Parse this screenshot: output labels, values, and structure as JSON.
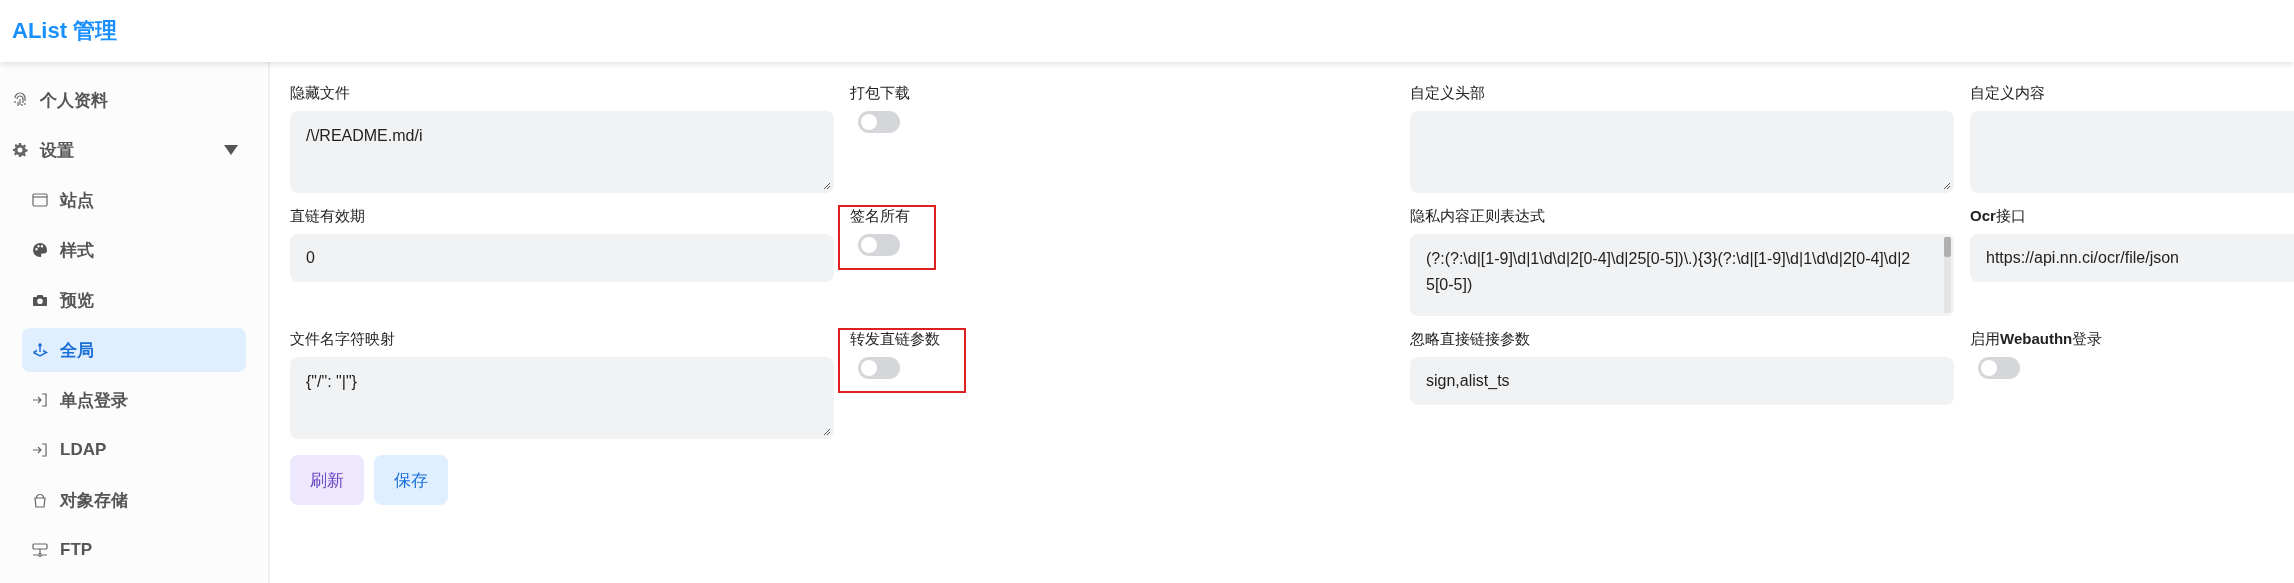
{
  "header": {
    "title": "AList 管理"
  },
  "sidebar": {
    "items": [
      {
        "label": "个人资料",
        "selected": false
      },
      {
        "label": "设置",
        "selected": false,
        "expanded": true,
        "children": [
          {
            "label": "站点",
            "selected": false
          },
          {
            "label": "样式",
            "selected": false
          },
          {
            "label": "预览",
            "selected": false
          },
          {
            "label": "全局",
            "selected": true
          },
          {
            "label": "单点登录",
            "selected": false
          },
          {
            "label": "LDAP",
            "selected": false
          },
          {
            "label": "对象存储",
            "selected": false
          },
          {
            "label": "FTP",
            "selected": false
          }
        ]
      }
    ]
  },
  "settings": [
    {
      "kind": "textarea",
      "label": "隐藏文件",
      "value": "/\\/README.md/i",
      "resizable": true,
      "highlighted": false
    },
    {
      "kind": "switch",
      "label": "打包下载",
      "on": false,
      "highlighted": false
    },
    {
      "kind": "textarea",
      "label": "自定义头部",
      "resizable": true,
      "highlighted": false
    },
    {
      "kind": "textarea",
      "label": "自定义内容",
      "highlighted": false
    },
    {
      "kind": "input",
      "label": "直链有效期",
      "value": "0",
      "highlighted": false
    },
    {
      "kind": "switch",
      "label": "签名所有",
      "on": false,
      "highlighted": true
    },
    {
      "kind": "textarea",
      "label": "隐私内容正则表达式",
      "value": "(?:(?:\\d|[1-9]\\d|1\\d\\d|2[0-4]\\d|25[0-5])\\.){3}(?:\\d|[1-9]\\d|1\\d\\d|2[0-4]\\d|25[0-5])",
      "scrollable": true,
      "highlighted": false
    },
    {
      "kind": "input",
      "label": "**Ocr**接口",
      "value": "https://api.nn.ci/ocr/file/json",
      "highlighted": false
    },
    {
      "kind": "textarea",
      "label": "文件名字符映射",
      "value": "{\"/\": \"|\"}",
      "resizable": true,
      "highlighted": false
    },
    {
      "kind": "switch",
      "label": "转发直链参数",
      "on": false,
      "highlighted": true
    },
    {
      "kind": "input",
      "label": "忽略直接链接参数",
      "value": "sign,alist_ts",
      "highlighted": false
    },
    {
      "kind": "switch",
      "label": "启用**Webauthn**登录",
      "on": false,
      "highlighted": false
    }
  ],
  "buttons": [
    {
      "label": "刷新",
      "kind": "refresh"
    },
    {
      "label": "保存",
      "kind": "save"
    }
  ]
}
